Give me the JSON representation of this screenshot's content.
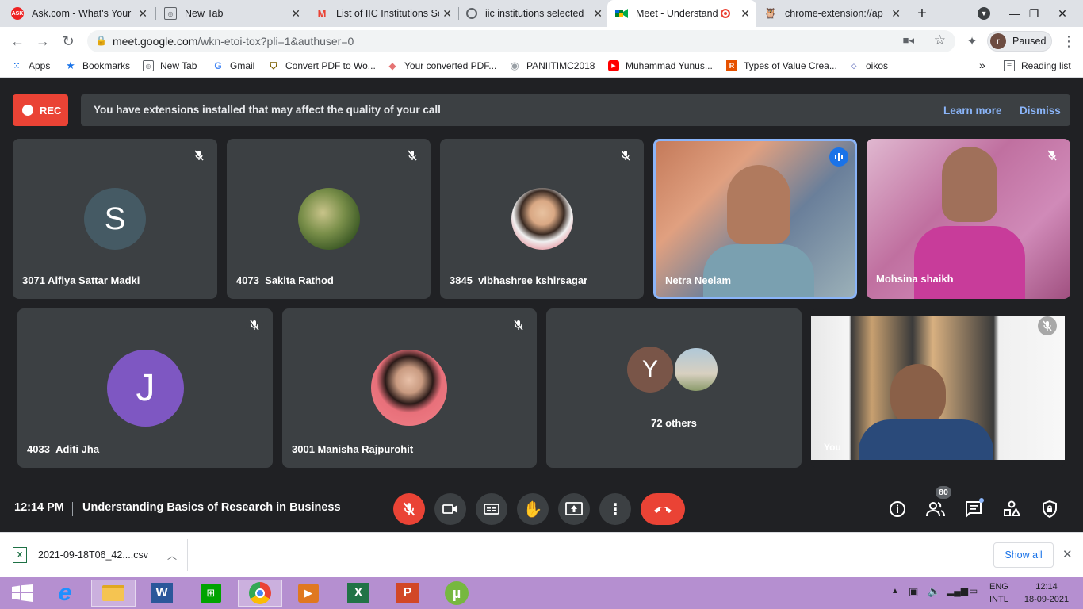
{
  "browser": {
    "tabs": [
      {
        "title": "Ask.com - What's Your",
        "favicon": "ask-logo-icon"
      },
      {
        "title": "New Tab",
        "favicon": "new-tab-icon"
      },
      {
        "title": "List of IIC Institutions Se",
        "favicon": "gmail-icon"
      },
      {
        "title": "iic institutions selected",
        "favicon": "globe-icon"
      },
      {
        "title": "Meet - Understand",
        "favicon": "meet-icon"
      },
      {
        "title": "chrome-extension://ap",
        "favicon": "owl-icon"
      }
    ],
    "url_host": "meet.google.com",
    "url_path": "/wkn-etoi-tox?pli=1&authuser=0",
    "profile_initial": "r",
    "profile_status": "Paused",
    "bookmarks": [
      "Apps",
      "Bookmarks",
      "New Tab",
      "Gmail",
      "Convert PDF to Wo...",
      "Your converted PDF...",
      "PANIITIMC2018",
      "Muhammad Yunus...",
      "Types of Value Crea...",
      "oikos"
    ],
    "reading_list": "Reading list",
    "overflow": "»"
  },
  "meet": {
    "rec_label": "REC",
    "banner_text": "You have extensions installed that may affect the quality of your call",
    "learn_more": "Learn more",
    "dismiss": "Dismiss",
    "participants_row1": [
      {
        "name": "3071 Alfiya Sattar Madki",
        "initial": "S",
        "avatar_color": "#455a64"
      },
      {
        "name": "4073_Sakita Rathod"
      },
      {
        "name": "3845_vibhashree kshirsagar"
      },
      {
        "name": "Netra Neelam"
      },
      {
        "name": "Mohsina shaikh"
      }
    ],
    "participants_row2": [
      {
        "name": "4033_Aditi Jha",
        "initial": "J",
        "avatar_color": "#7e57c2"
      },
      {
        "name": "3001 Manisha Rajpurohit"
      },
      {
        "name": "72 others",
        "initial": "Y",
        "avatar_color": "#795548"
      },
      {
        "name": "You"
      }
    ],
    "time": "12:14 PM",
    "meeting_title": "Understanding Basics of Research in Business",
    "participant_count": "80"
  },
  "downloads": {
    "file": "2021-09-18T06_42....csv",
    "show_all": "Show all"
  },
  "taskbar": {
    "lang_top": "ENG",
    "lang_bottom": "INTL",
    "clock_time": "12:14",
    "clock_date": "18-09-2021"
  },
  "colors": {
    "meet_bg": "#202124",
    "tile_bg": "#3c4043",
    "red": "#ea4335",
    "link": "#8ab4f8",
    "speaking_border": "#8ab4f8",
    "taskbar": "#b58fd0"
  }
}
